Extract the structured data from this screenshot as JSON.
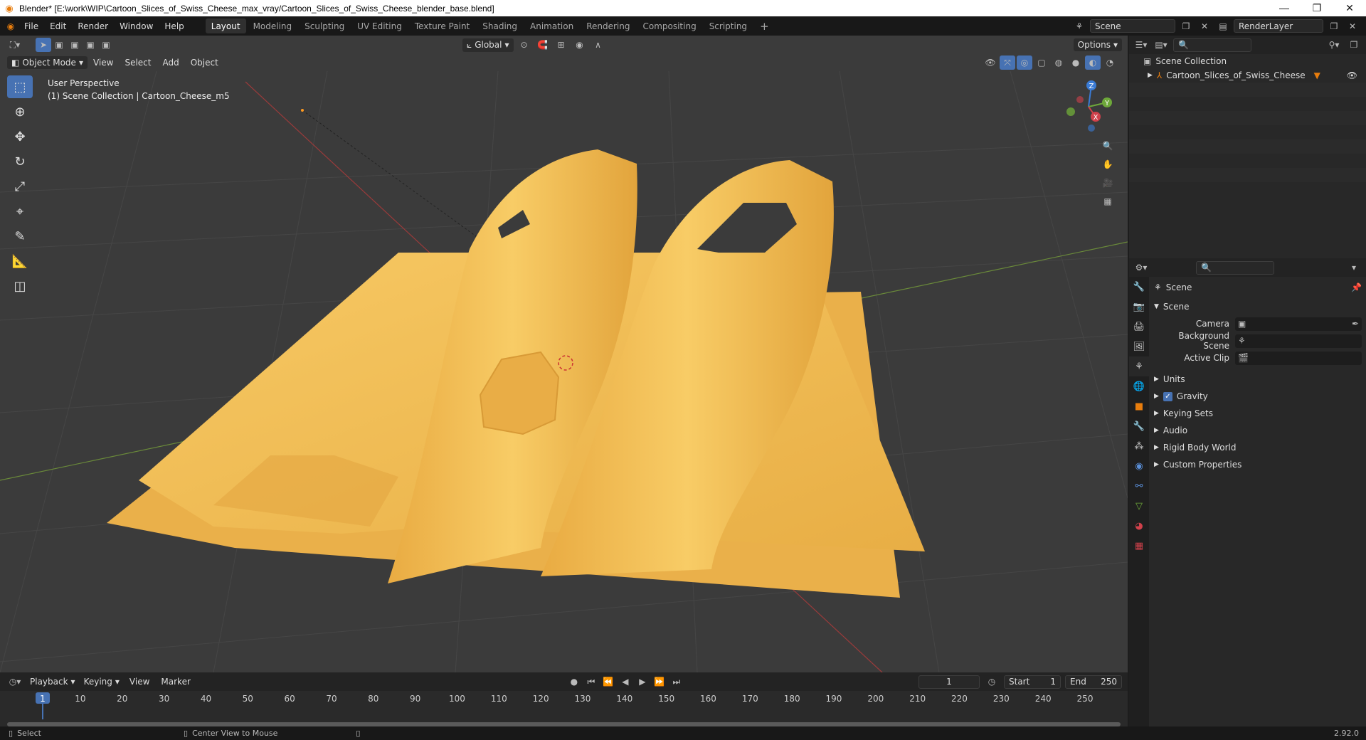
{
  "window": {
    "title": "Blender* [E:\\work\\WIP\\Cartoon_Slices_of_Swiss_Cheese_max_vray/Cartoon_Slices_of_Swiss_Cheese_blender_base.blend]",
    "minimize": "—",
    "maximize": "❐",
    "close": "✕"
  },
  "menu": [
    "File",
    "Edit",
    "Render",
    "Window",
    "Help"
  ],
  "workspaces": [
    "Layout",
    "Modeling",
    "Sculpting",
    "UV Editing",
    "Texture Paint",
    "Shading",
    "Animation",
    "Rendering",
    "Compositing",
    "Scripting"
  ],
  "active_workspace": "Layout",
  "add_workspace": "+",
  "scene_selector": "Scene",
  "renderlayer_selector": "RenderLayer",
  "viewport": {
    "transform_orientation": "Global",
    "options_label": "Options",
    "mode": "Object Mode",
    "header_menu": [
      "View",
      "Select",
      "Add",
      "Object"
    ],
    "perspective_label": "User Perspective",
    "collection_label": "(1) Scene Collection | Cartoon_Cheese_m5",
    "gizmo_axes": {
      "z": "Z",
      "y": "Y",
      "x": "X"
    }
  },
  "outliner": {
    "root": "Scene Collection",
    "items": [
      {
        "label": "Cartoon_Slices_of_Swiss_Cheese"
      }
    ]
  },
  "properties": {
    "context_title": "Scene",
    "section": "Scene",
    "fields": [
      {
        "label": "Camera",
        "value": ""
      },
      {
        "label": "Background Scene",
        "value": ""
      },
      {
        "label": "Active Clip",
        "value": ""
      }
    ],
    "subpanels": [
      {
        "label": "Units",
        "checkbox": false
      },
      {
        "label": "Gravity",
        "checkbox": true
      },
      {
        "label": "Keying Sets",
        "checkbox": false
      },
      {
        "label": "Audio",
        "checkbox": false
      },
      {
        "label": "Rigid Body World",
        "checkbox": false
      },
      {
        "label": "Custom Properties",
        "checkbox": false
      }
    ]
  },
  "timeline": {
    "menu": [
      "Playback",
      "Keying",
      "View",
      "Marker"
    ],
    "current_frame": "1",
    "start_label": "Start",
    "start_value": "1",
    "end_label": "End",
    "end_value": "250",
    "ticks": [
      "1",
      "10",
      "20",
      "30",
      "40",
      "50",
      "60",
      "70",
      "80",
      "90",
      "100",
      "110",
      "120",
      "130",
      "140",
      "150",
      "160",
      "170",
      "180",
      "190",
      "200",
      "210",
      "220",
      "230",
      "240",
      "250"
    ]
  },
  "statusbar": {
    "select": "Select",
    "center_view": "Center View to Mouse",
    "version": "2.92.0"
  },
  "colors": {
    "accent": "#4772b3",
    "cheese": "#f0bd55",
    "viewport_bg": "#3b3b3b"
  }
}
